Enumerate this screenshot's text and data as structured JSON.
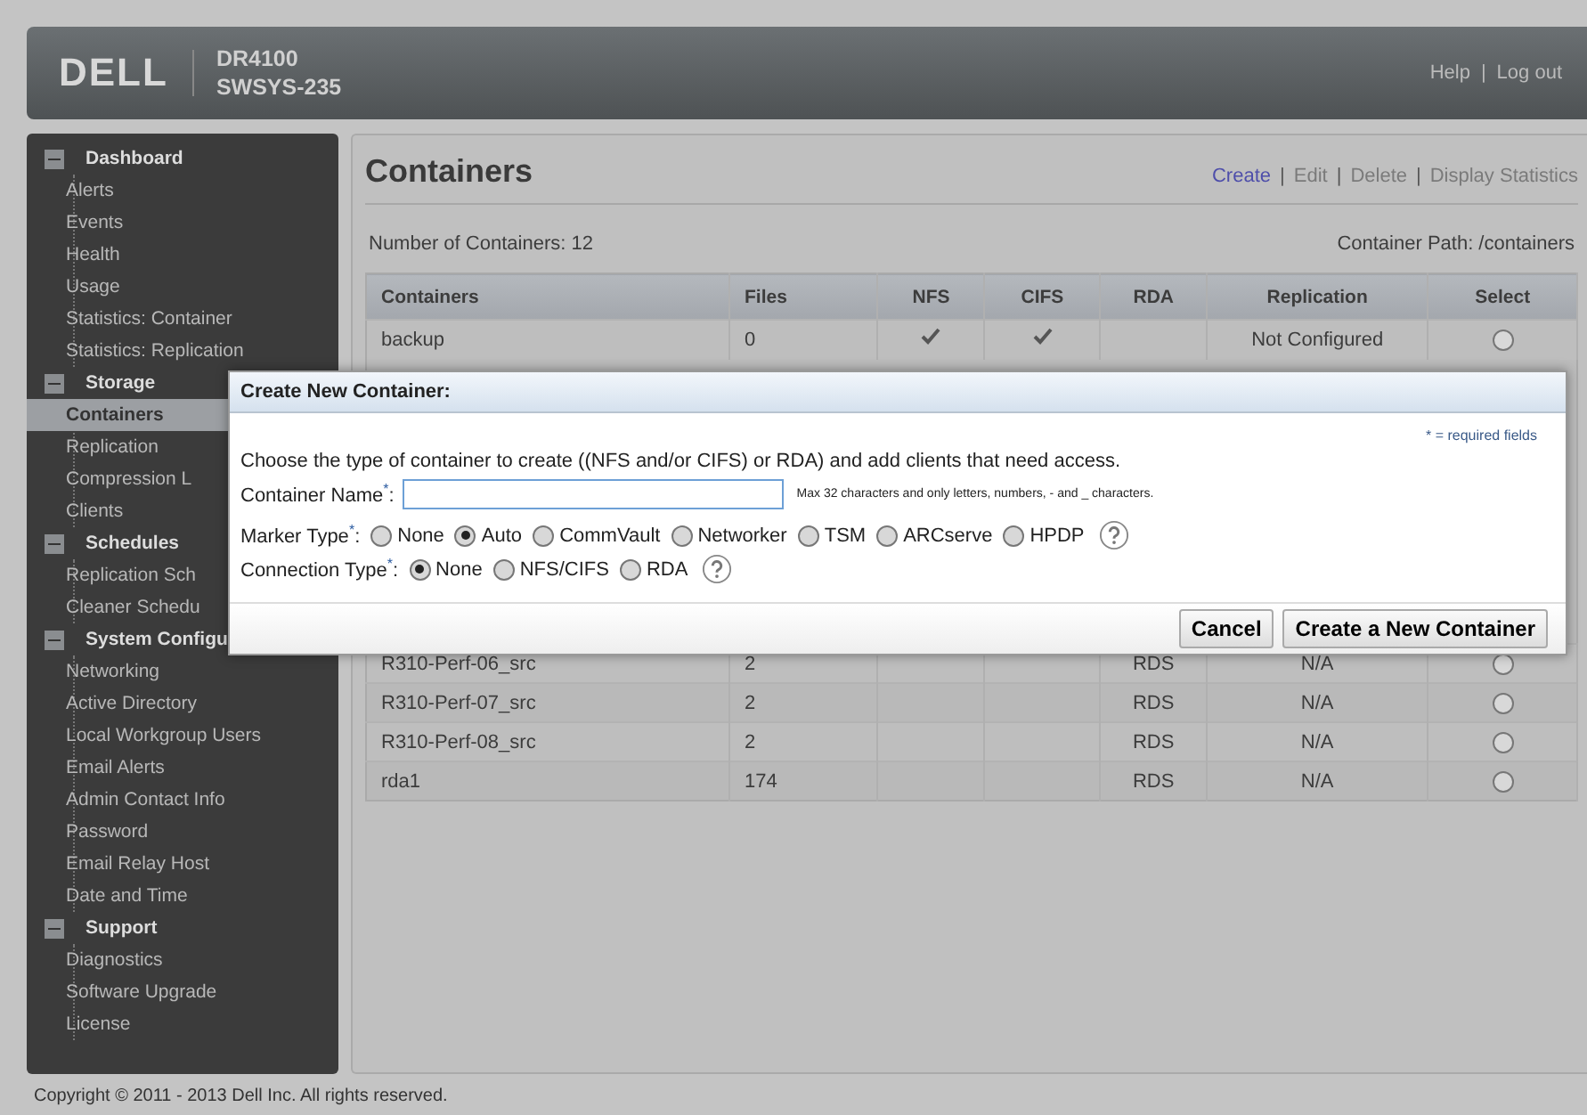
{
  "header": {
    "logo": "DELL",
    "product": "DR4100",
    "host": "SWSYS-235",
    "links": [
      {
        "label": "Help"
      },
      {
        "label": "Log out"
      }
    ],
    "separator": "|"
  },
  "sidebar": {
    "sections": [
      {
        "label": "Dashboard",
        "expanded": true,
        "children": [
          {
            "label": "Alerts",
            "selected": false
          },
          {
            "label": "Events",
            "selected": false
          },
          {
            "label": "Health",
            "selected": false
          },
          {
            "label": "Usage",
            "selected": false
          },
          {
            "label": "Statistics: Container",
            "selected": false
          },
          {
            "label": "Statistics: Replication",
            "selected": false
          }
        ]
      },
      {
        "label": "Storage",
        "expanded": true,
        "children": [
          {
            "label": "Containers",
            "selected": true
          },
          {
            "label": "Replication",
            "selected": false
          },
          {
            "label": "Compression L",
            "selected": false
          },
          {
            "label": "Clients",
            "selected": false
          }
        ]
      },
      {
        "label": "Schedules",
        "expanded": true,
        "children": [
          {
            "label": "Replication Sch",
            "selected": false
          },
          {
            "label": "Cleaner Schedu",
            "selected": false
          }
        ]
      },
      {
        "label": "System Configu",
        "expanded": true,
        "children": [
          {
            "label": "Networking",
            "selected": false
          },
          {
            "label": "Active Directory",
            "selected": false
          },
          {
            "label": "Local Workgroup Users",
            "selected": false
          },
          {
            "label": "Email Alerts",
            "selected": false
          },
          {
            "label": "Admin Contact Info",
            "selected": false
          },
          {
            "label": "Password",
            "selected": false
          },
          {
            "label": "Email Relay Host",
            "selected": false
          },
          {
            "label": "Date and Time",
            "selected": false
          }
        ]
      },
      {
        "label": "Support",
        "expanded": true,
        "children": [
          {
            "label": "Diagnostics",
            "selected": false
          },
          {
            "label": "Software Upgrade",
            "selected": false
          },
          {
            "label": "License",
            "selected": false
          }
        ]
      }
    ]
  },
  "main": {
    "title": "Containers",
    "actions": [
      {
        "label": "Create",
        "disabled": false
      },
      {
        "label": "Edit",
        "disabled": true
      },
      {
        "label": "Delete",
        "disabled": true
      },
      {
        "label": "Display Statistics",
        "disabled": true
      }
    ],
    "separator": "|",
    "count": "Number of Containers: 12",
    "path": "Container Path: /containers",
    "table": {
      "columns": [
        "Containers",
        "Files",
        "NFS",
        "CIFS",
        "RDA",
        "Replication",
        "Select"
      ],
      "rows": [
        {
          "name": "backup",
          "files": "0",
          "nfs": true,
          "cifs": true,
          "rda": "",
          "replication": "Not Configured",
          "selected": false
        },
        {
          "name": "R310-Perf-06_src",
          "files": "2",
          "nfs": false,
          "cifs": false,
          "rda": "RDS",
          "replication": "N/A",
          "selected": false
        },
        {
          "name": "R310-Perf-07_src",
          "files": "2",
          "nfs": false,
          "cifs": false,
          "rda": "RDS",
          "replication": "N/A",
          "selected": false
        },
        {
          "name": "R310-Perf-08_src",
          "files": "2",
          "nfs": false,
          "cifs": false,
          "rda": "RDS",
          "replication": "N/A",
          "selected": false
        },
        {
          "name": "rda1",
          "files": "174",
          "nfs": false,
          "cifs": false,
          "rda": "RDS",
          "replication": "N/A",
          "selected": false
        }
      ]
    }
  },
  "dialog": {
    "title": "Create New Container:",
    "required_note": "* = required fields",
    "description": "Choose the type of container to create ((NFS and/or CIFS) or RDA) and add clients that need access.",
    "name_label": "Container Name$^{*}$:",
    "name_hint": "Max 32 characters and only letters, numbers, - and _ characters.",
    "groups": [
      {
        "label": "Marker Type$^{*}$:",
        "options": [
          {
            "label": "None",
            "selected": false
          },
          {
            "label": "Auto",
            "selected": true
          },
          {
            "label": "CommVault",
            "selected": false
          },
          {
            "label": "Networker",
            "selected": false
          },
          {
            "label": "TSM",
            "selected": false
          },
          {
            "label": "ARCserve",
            "selected": false
          },
          {
            "label": "HPDP",
            "selected": false
          }
        ]
      },
      {
        "label": "Connection Type$^{*}$:",
        "options": [
          {
            "label": "None",
            "selected": true
          },
          {
            "label": "NFS/CIFS",
            "selected": false
          },
          {
            "label": "RDA",
            "selected": false
          }
        ]
      }
    ],
    "buttons": [
      "Cancel",
      "Create a New Container"
    ]
  },
  "footer": "Copyright © 2011 - 2013 Dell Inc. All rights reserved."
}
